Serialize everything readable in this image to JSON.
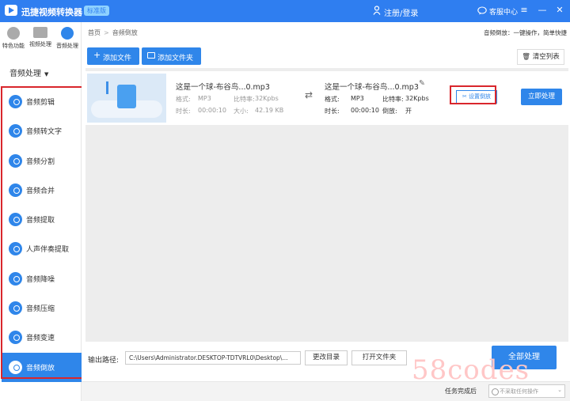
{
  "titlebar": {
    "app_title": "迅捷视频转换器",
    "edition": "标准版",
    "login": "注册/登录",
    "customer_service": "客服中心",
    "controls": [
      "≡",
      "—",
      "✕"
    ]
  },
  "sidebar": {
    "top_nav": [
      {
        "label": "特色功能",
        "icon": "star-icon"
      },
      {
        "label": "视频处理",
        "icon": "film-icon"
      },
      {
        "label": "音频处理",
        "icon": "music-icon",
        "active": true
      }
    ],
    "category": "音频处理",
    "items": [
      {
        "label": "音频剪辑"
      },
      {
        "label": "音频转文字"
      },
      {
        "label": "音频分割"
      },
      {
        "label": "音频合并"
      },
      {
        "label": "音频提取"
      },
      {
        "label": "人声伴奏提取"
      },
      {
        "label": "音频降噪"
      },
      {
        "label": "音频压缩"
      },
      {
        "label": "音频变速"
      },
      {
        "label": "音频倒放",
        "active": true
      }
    ]
  },
  "main": {
    "breadcrumb": [
      "首页",
      "音频倒放"
    ],
    "description": "音频倒放：一键操作，简单快捷",
    "add_file": "添加文件",
    "add_folder": "添加文件夹",
    "clear_list": "清空列表",
    "file": {
      "source_name": "这是一个球-布谷鸟...0.mp3",
      "source_format_label": "格式:",
      "source_format": "MP3",
      "source_bitrate_label": "比特率:",
      "source_bitrate": "32Kpbs",
      "source_duration_label": "时长:",
      "source_duration": "00:00:10",
      "source_size_label": "大小:",
      "source_size": "42.19 KB",
      "target_name": "这是一个球-布谷鸟...0.mp3",
      "target_format_label": "格式:",
      "target_format": "MP3",
      "target_bitrate_label": "比特率:",
      "target_bitrate": "32Kpbs",
      "target_duration_label": "时长:",
      "target_duration": "00:00:10",
      "target_reverse_label": "倒放:",
      "target_reverse": "开",
      "set_reverse": "设置倒放",
      "process_now": "立即处理"
    }
  },
  "bottom": {
    "output_label": "输出路径:",
    "output_path": "C:\\Users\\Administrator.DESKTOP-TDTVRL0\\Desktop\\...",
    "change_dir": "更改目录",
    "open_folder": "打开文件夹",
    "process_all": "全部处理"
  },
  "footer": {
    "after_task": "任务完成后",
    "after_task_option": "不采取任何操作"
  },
  "watermark": "58codes",
  "colors": {
    "accent": "#2f86ea",
    "titlebar": "#2f7ef0",
    "highlight": "#d9262c"
  }
}
